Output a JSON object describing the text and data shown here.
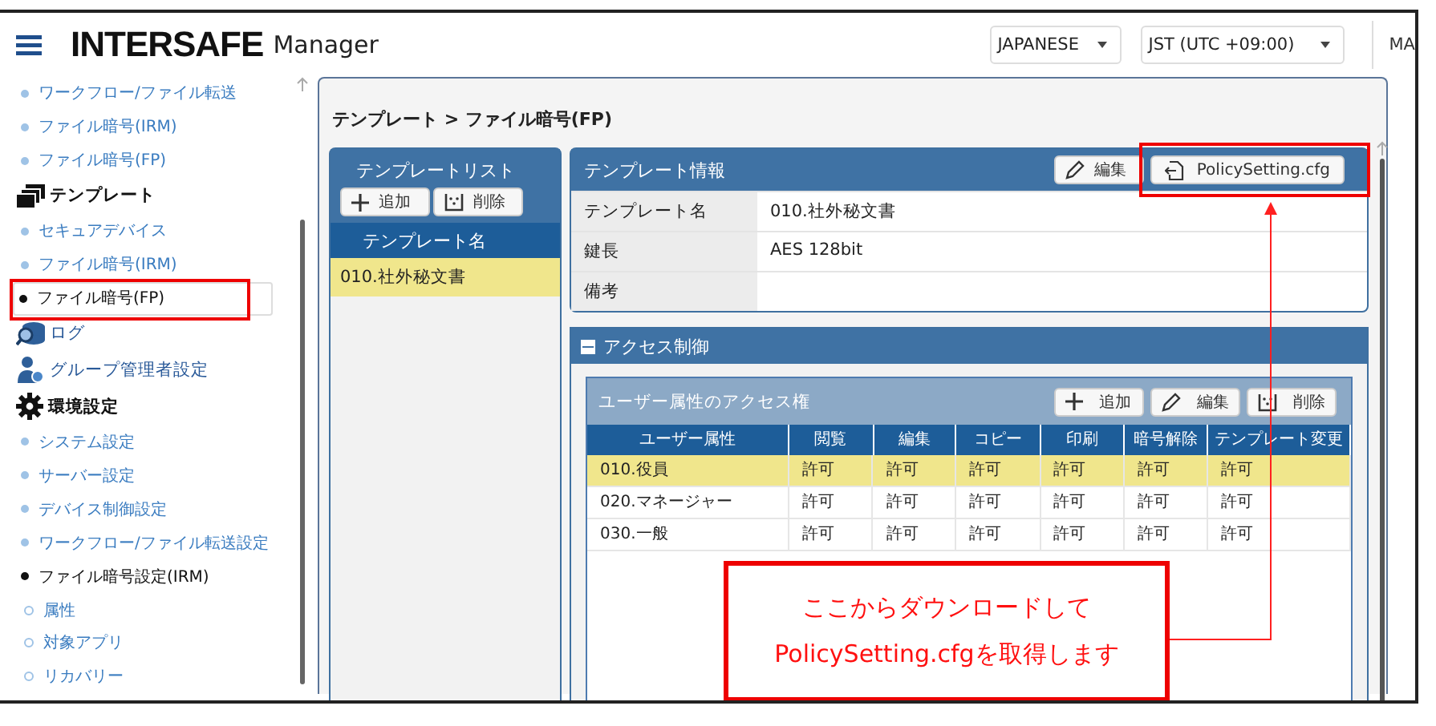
{
  "header": {
    "brand": "INTERSAFE",
    "product": "Manager",
    "language": "JAPANESE",
    "timezone": "JST (UTC +09:00)",
    "user": "MA"
  },
  "sidebar": {
    "items": [
      {
        "kind": "link",
        "label": "ワークフロー/ファイル転送",
        "active": false,
        "selected": false
      },
      {
        "kind": "link",
        "label": "ファイル暗号(IRM)",
        "active": false,
        "selected": false
      },
      {
        "kind": "link",
        "label": "ファイル暗号(FP)",
        "active": false,
        "selected": false
      },
      {
        "kind": "group",
        "label": "テンプレート"
      },
      {
        "kind": "link",
        "label": "セキュアデバイス",
        "active": false,
        "selected": false
      },
      {
        "kind": "link",
        "label": "ファイル暗号(IRM)",
        "active": false,
        "selected": false
      },
      {
        "kind": "link",
        "label": "ファイル暗号(FP)",
        "active": true,
        "selected": true
      },
      {
        "kind": "group",
        "label": "ログ"
      },
      {
        "kind": "group",
        "label": "グループ管理者設定"
      },
      {
        "kind": "group",
        "label": "環境設定"
      },
      {
        "kind": "link",
        "label": "システム設定",
        "active": false,
        "selected": false
      },
      {
        "kind": "link",
        "label": "サーバー設定",
        "active": false,
        "selected": false
      },
      {
        "kind": "link",
        "label": "デバイス制御設定",
        "active": false,
        "selected": false
      },
      {
        "kind": "link",
        "label": "ワークフロー/ファイル転送設定",
        "active": false,
        "selected": false
      },
      {
        "kind": "link",
        "label": "ファイル暗号設定(IRM)",
        "active": true,
        "selected": false
      },
      {
        "kind": "option",
        "label": "属性"
      },
      {
        "kind": "option",
        "label": "対象アプリ"
      },
      {
        "kind": "option",
        "label": "リカバリー"
      }
    ]
  },
  "breadcrumb": "テンプレート > ファイル暗号(FP)",
  "template_list": {
    "title": "テンプレートリスト",
    "buttons": [
      "追加",
      "削除"
    ],
    "column": "テンプレート名",
    "rows": [
      {
        "name": "010.社外秘文書",
        "selected": true
      }
    ]
  },
  "template_info": {
    "title": "テンプレート情報",
    "buttons": [
      "編集",
      "PolicySetting.cfg"
    ],
    "fields": [
      {
        "label": "テンプレート名",
        "value": "010.社外秘文書"
      },
      {
        "label": "鍵長",
        "value": "AES 128bit"
      },
      {
        "label": "備考"
      }
    ]
  },
  "access_control": {
    "title": "アクセス制御",
    "expanded": true,
    "subtitle": "ユーザー属性のアクセス権",
    "buttons": [
      "追加",
      "編集",
      "削除"
    ],
    "columns": [
      "ユーザー属性",
      "閲覧",
      "編集",
      "コピー",
      "印刷",
      "暗号解除",
      "テンプレート変更"
    ],
    "rows": [
      {
        "cells": [
          "010.役員",
          "許可",
          "許可",
          "許可",
          "許可",
          "許可",
          "許可"
        ],
        "selected": true
      },
      {
        "cells": [
          "020.マネージャー",
          "許可",
          "許可",
          "許可",
          "許可",
          "許可",
          "許可"
        ],
        "selected": false
      },
      {
        "cells": [
          "030.一般",
          "許可",
          "許可",
          "許可",
          "許可",
          "許可",
          "許可"
        ],
        "selected": false
      }
    ]
  },
  "callout": {
    "lines": [
      "ここからダウンロードして",
      "PolicySetting.cfgを取得します"
    ]
  }
}
